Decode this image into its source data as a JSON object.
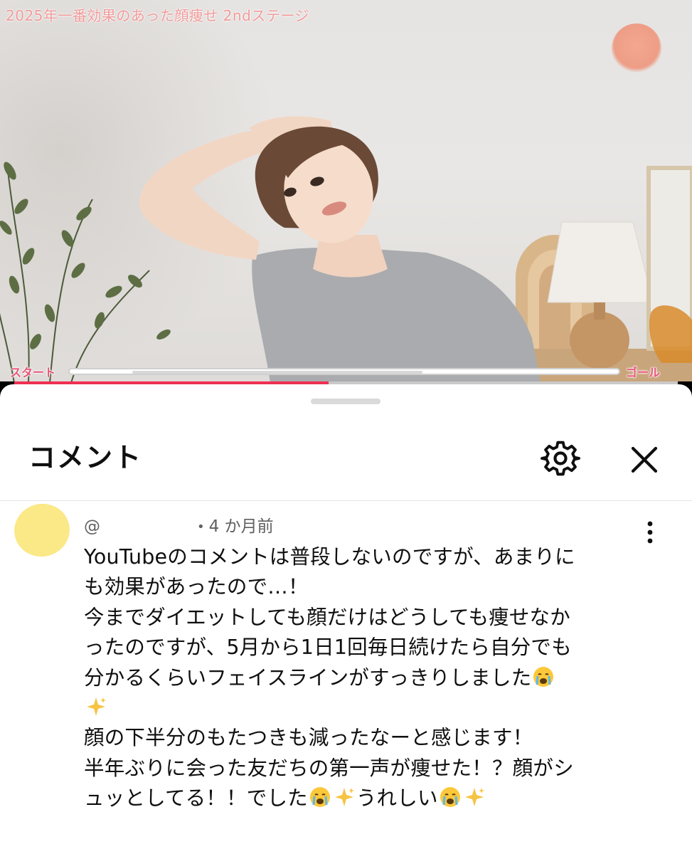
{
  "video": {
    "overlay_title": "2025年一番効果のあった顔痩せ  2ndステージ",
    "progress_start_label": "スタート",
    "progress_goal_label": "ゴール",
    "overlay_progress": 0.6,
    "seek_progress": 0.475,
    "seek_color": "#ef2f51"
  },
  "comments_panel": {
    "title": "コメント",
    "settings_icon": "gear-icon",
    "close_icon": "close-icon"
  },
  "comment": {
    "author_prefix": "@",
    "separator": "•",
    "time": "4 か月前",
    "avatar_color": "#fbe887",
    "lines": [
      "YouTubeのコメントは普段しないのですが、あまりに",
      "も効果があったので…！",
      "今までダイエットしても顔だけはどうしても痩せなか",
      "ったのですが、5月から1日1回毎日続けたら自分でも",
      "分かるくらいフェイスラインがすっきりしました",
      "顔の下半分のもたつきも減ったなーと感じます！",
      "半年ぶりに会った友だちの第一声が痩せた！？顔がシ",
      "ュッとしてる！！でした",
      "うれしい"
    ],
    "emojis": [
      "crying-face",
      "sparkles"
    ]
  }
}
